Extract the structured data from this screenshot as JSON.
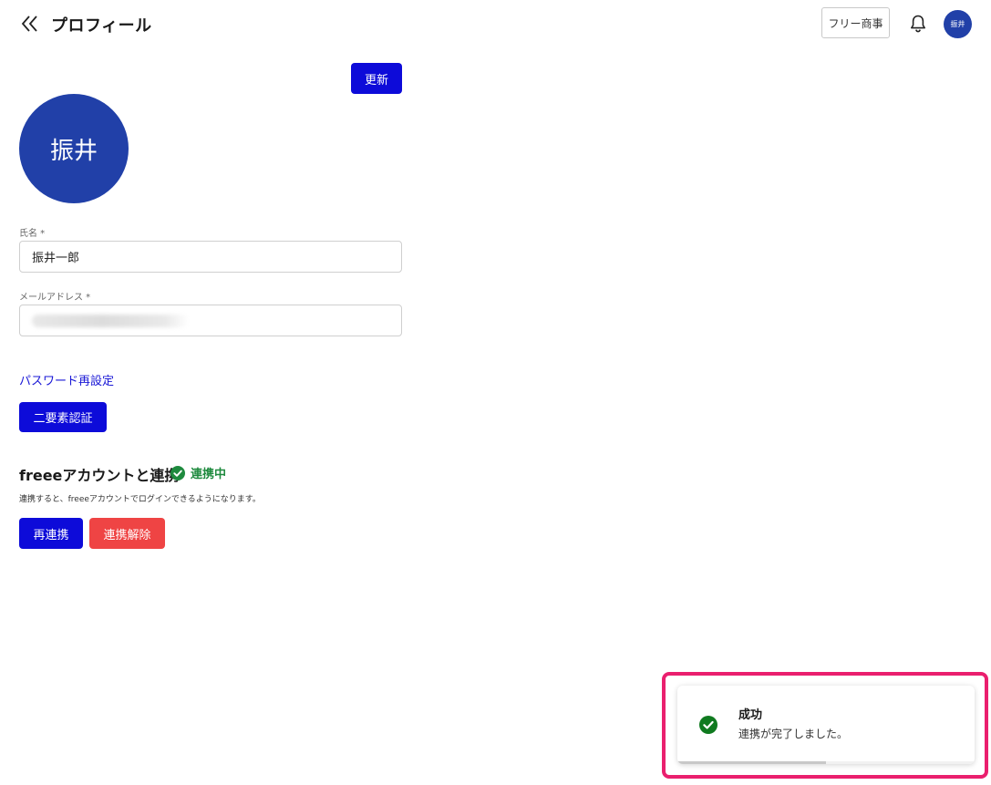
{
  "header": {
    "back_icon": "double-chevron-left-icon",
    "title": "プロフィール",
    "company_button": "フリー商事",
    "bell_icon": "bell-icon",
    "avatar_initials": "振井"
  },
  "profile": {
    "update_button": "更新",
    "avatar_text": "振井",
    "name_label": "氏名 *",
    "name_value": "振井一郎",
    "email_label": "メールアドレス *",
    "email_value": "",
    "password_reset_link": "パスワード再設定",
    "mfa_button": "二要素認証"
  },
  "freee": {
    "title": "freeeアカウントと連携",
    "status_icon": "check-circle-icon",
    "status_text": "連携中",
    "status_color": "#1e8a3e",
    "description": "連携すると、freeeアカウントでログインできるようになります。",
    "relink_button": "再連携",
    "unlink_button": "連携解除"
  },
  "toast": {
    "icon": "check-circle-icon",
    "title": "成功",
    "message": "連携が完了しました。",
    "progress": 0.5,
    "highlight_color": "#ea1f6e"
  },
  "colors": {
    "primary": "#0d0bd9",
    "danger": "#ef4444",
    "avatar": "#2140a8",
    "success": "#1e8a3e"
  }
}
